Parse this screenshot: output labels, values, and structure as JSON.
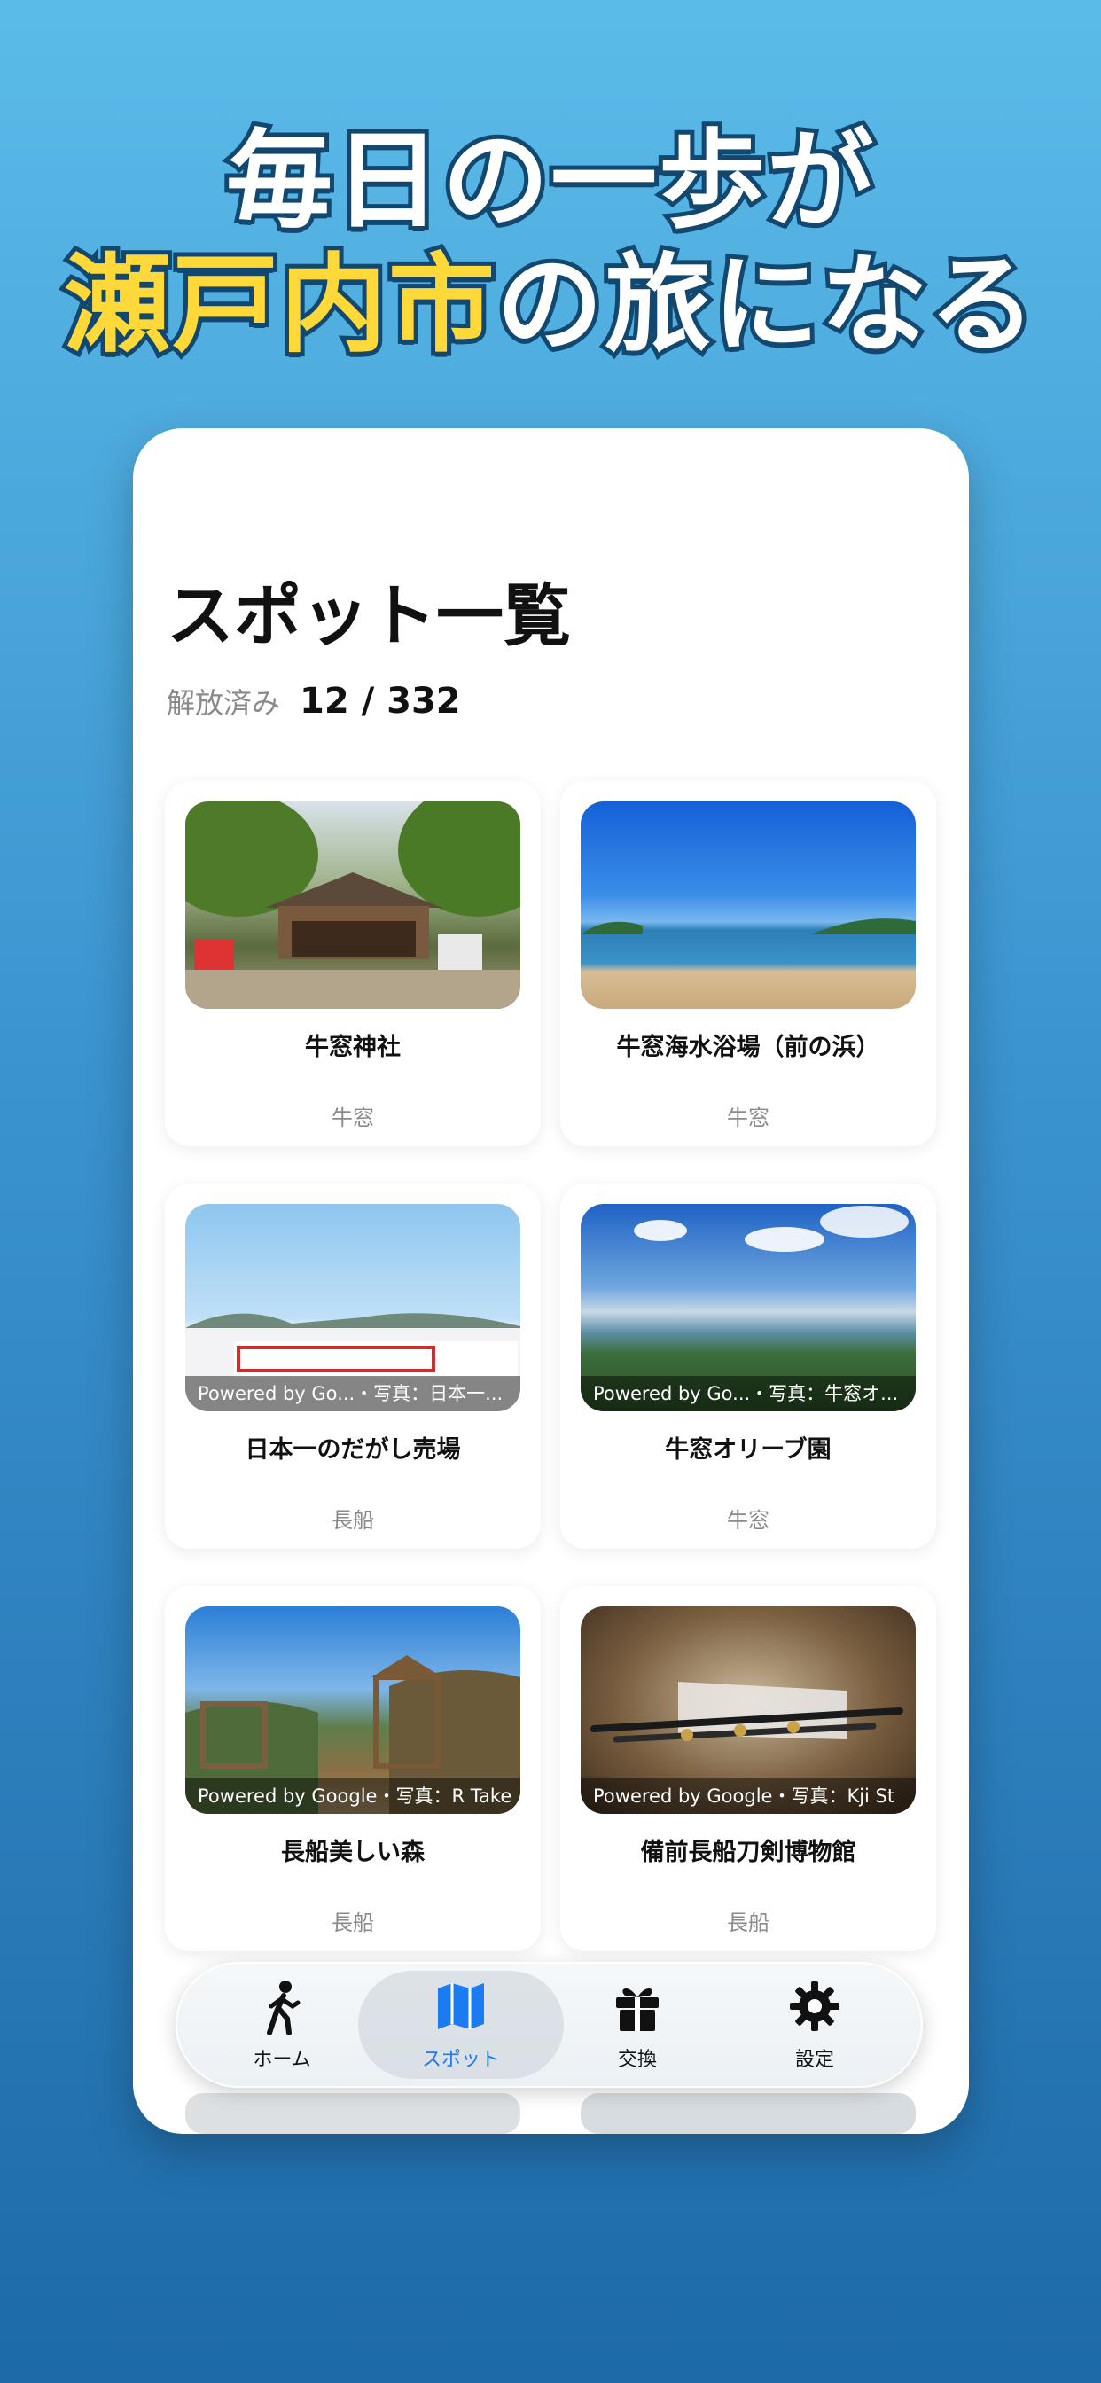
{
  "headline": {
    "line1": "毎日の一歩が",
    "line2_highlight": "瀬戸内市",
    "line2_rest": "の旅になる"
  },
  "screen": {
    "title": "スポット一覧",
    "progress_label": "解放済み",
    "progress_value": "12 / 332"
  },
  "spots": [
    {
      "name": "牛窓神社",
      "area": "牛窓",
      "credit": ""
    },
    {
      "name": "牛窓海水浴場（前の浜）",
      "area": "牛窓",
      "credit": ""
    },
    {
      "name": "日本一のだがし売場",
      "area": "長船",
      "credit": "Powered by Go...・写真：日本一..."
    },
    {
      "name": "牛窓オリーブ園",
      "area": "牛窓",
      "credit": "Powered by Go...・写真：牛窓オ..."
    },
    {
      "name": "長船美しい森",
      "area": "長船",
      "credit": "Powered by Google・写真：R Take"
    },
    {
      "name": "備前長船刀剣博物館",
      "area": "長船",
      "credit": "Powered by Google・写真：Kji St"
    }
  ],
  "nav": {
    "items": [
      {
        "label": "ホーム",
        "icon": "walking-person-icon"
      },
      {
        "label": "スポット",
        "icon": "map-icon"
      },
      {
        "label": "交換",
        "icon": "gift-icon"
      },
      {
        "label": "設定",
        "icon": "gear-icon"
      }
    ],
    "active_color": "#1a7cf0"
  },
  "colors": {
    "highlight_yellow": "#ffd83a",
    "outline_navy": "#12476f"
  }
}
